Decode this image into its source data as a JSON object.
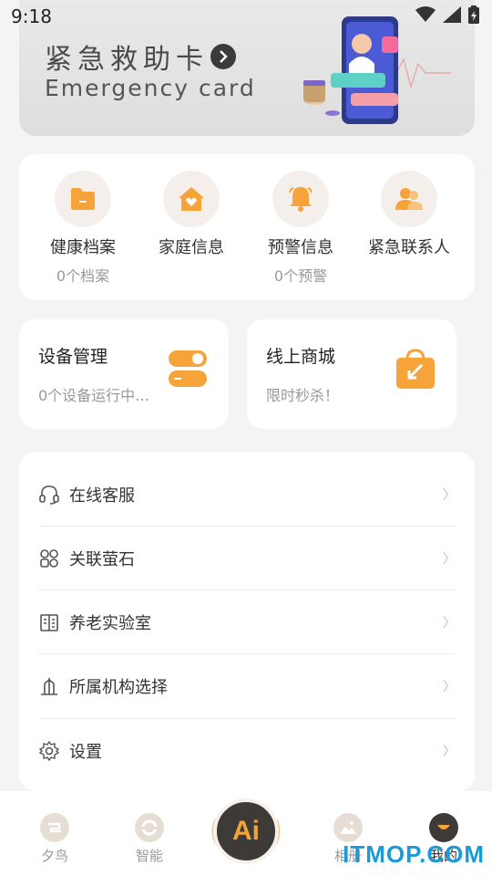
{
  "status": {
    "time": "9:18"
  },
  "banner": {
    "title": "紧急救助卡",
    "subtitle": "Emergency card"
  },
  "quick": [
    {
      "label": "健康档案",
      "sub": "0个档案",
      "icon": "folder-icon"
    },
    {
      "label": "家庭信息",
      "sub": "",
      "icon": "home-heart-icon"
    },
    {
      "label": "预警信息",
      "sub": "0个预警",
      "icon": "bell-icon"
    },
    {
      "label": "紧急联系人",
      "sub": "",
      "icon": "contacts-icon"
    }
  ],
  "device": {
    "title": "设备管理",
    "sub": "0个设备运行中…"
  },
  "shop": {
    "title": "线上商城",
    "sub": "限时秒杀！"
  },
  "menu": [
    {
      "label": "在线客服",
      "icon": "headset-icon"
    },
    {
      "label": "关联萤石",
      "icon": "grid-link-icon"
    },
    {
      "label": "养老实验室",
      "icon": "building-icon"
    },
    {
      "label": "所属机构选择",
      "icon": "institution-icon"
    },
    {
      "label": "设置",
      "icon": "gear-icon"
    }
  ],
  "menu_arrow": "〉",
  "tabs": [
    {
      "label": "夕鸟"
    },
    {
      "label": "智能"
    },
    {
      "label": "相册"
    },
    {
      "label": "我的"
    }
  ],
  "ai_label": "Ai",
  "watermark": "ITMOP.COM",
  "colors": {
    "accent": "#f6a43a",
    "icon_bg": "#f4efea",
    "ai_bg": "#3d3a38"
  }
}
